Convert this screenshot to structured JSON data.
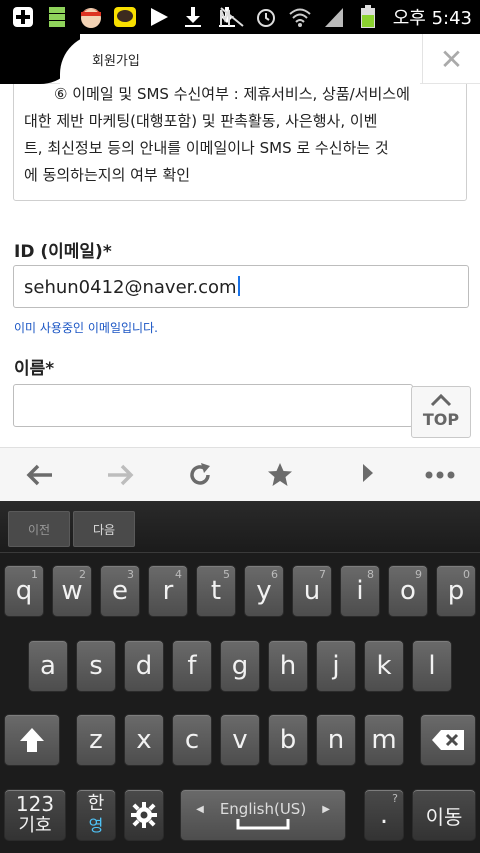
{
  "status_bar": {
    "icons": [
      "plus-icon",
      "storage-icon",
      "avatar-icon",
      "talk-icon",
      "play-icon",
      "download-icon",
      "download-icon",
      "mute-icon",
      "alarm-icon",
      "wifi-icon",
      "signal-icon",
      "battery-icon"
    ],
    "time": "오후 5:43"
  },
  "tab": {
    "title": "회원가입",
    "close_label": "✕"
  },
  "terms": {
    "lines": [
      "⑥ 이메일 및 SMS 수신여부 : 제휴서비스, 상품/서비스에",
      "대한 제반 마케팅(대행포함) 및 판촉활동, 사은행사, 이벤",
      "트, 최신정보 등의 안내를 이메일이나 SMS 로 수신하는 것",
      "에 동의하는지의 여부 확인"
    ]
  },
  "form": {
    "id_label": "ID (이메일)*",
    "id_value": "sehun0412@naver.com",
    "id_message": "이미 사용중인 이메일입니다.",
    "name_label": "이름*",
    "name_value": ""
  },
  "top_button": {
    "label": "TOP"
  },
  "browser_nav": [
    "back-icon",
    "forward-icon",
    "refresh-icon",
    "bookmark-icon",
    "share-icon",
    "more-icon"
  ],
  "keyboard": {
    "prev_label": "이전",
    "next_label": "다음",
    "row1": [
      {
        "k": "q",
        "n": "1"
      },
      {
        "k": "w",
        "n": "2"
      },
      {
        "k": "e",
        "n": "3"
      },
      {
        "k": "r",
        "n": "4"
      },
      {
        "k": "t",
        "n": "5"
      },
      {
        "k": "y",
        "n": "6"
      },
      {
        "k": "u",
        "n": "7"
      },
      {
        "k": "i",
        "n": "8"
      },
      {
        "k": "o",
        "n": "9"
      },
      {
        "k": "p",
        "n": "0"
      }
    ],
    "row2": [
      "a",
      "s",
      "d",
      "f",
      "g",
      "h",
      "j",
      "k",
      "l"
    ],
    "row3": [
      "z",
      "x",
      "c",
      "v",
      "b",
      "n",
      "m"
    ],
    "sym_key_line1": "123",
    "sym_key_line2": "기호",
    "lang_key_han": "한",
    "lang_key_eng": "영",
    "space_label": "English(US)",
    "period_label": ".",
    "period_hint": "?",
    "enter_label": "이동"
  }
}
